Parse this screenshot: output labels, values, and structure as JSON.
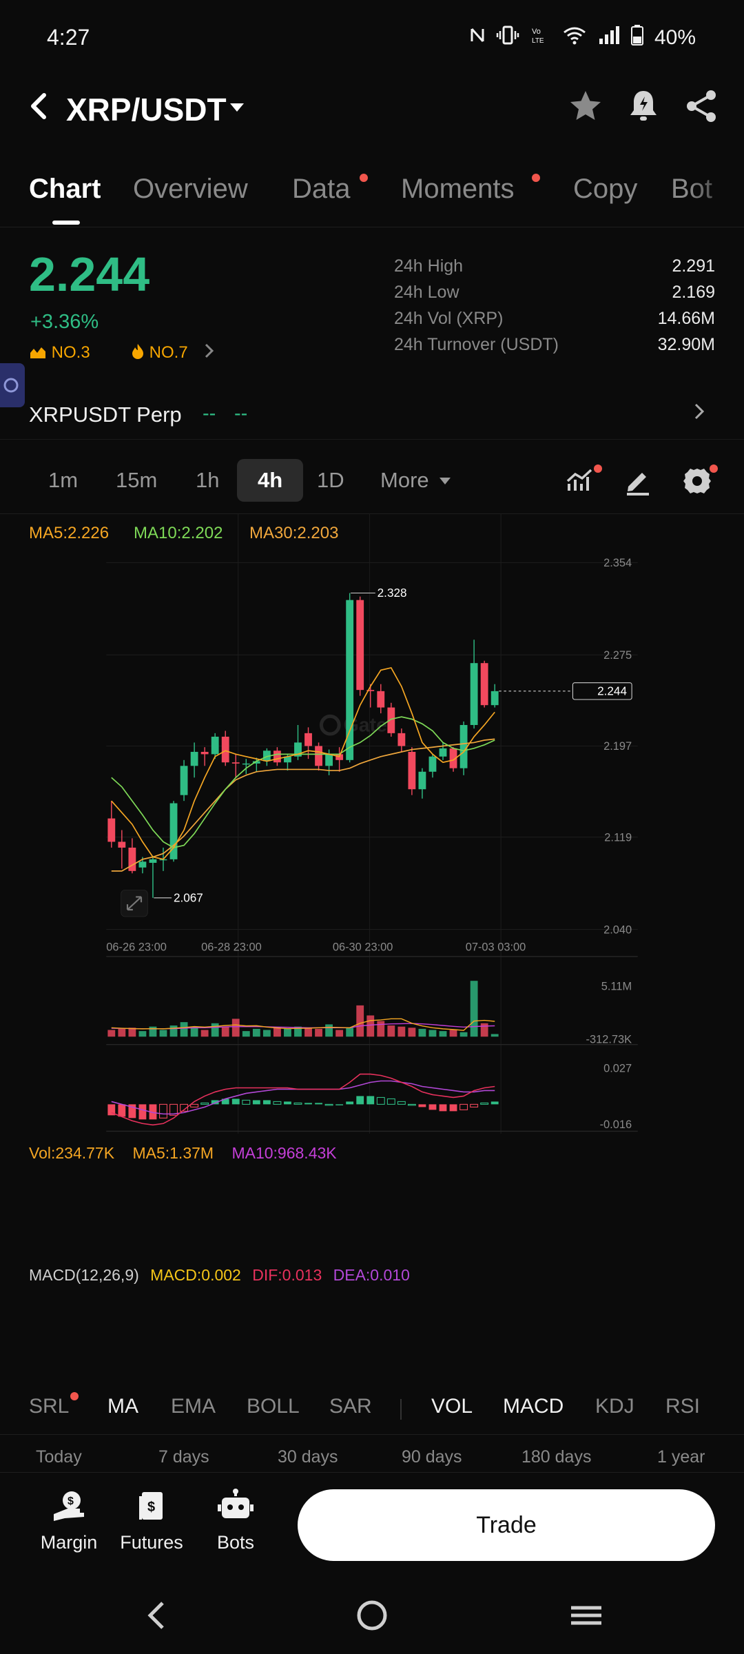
{
  "status_bar": {
    "time": "4:27",
    "battery": "40%",
    "icons": [
      "nfc-icon",
      "vibrate-icon",
      "volte-icon",
      "wifi-icon",
      "signal-icon",
      "battery-icon"
    ]
  },
  "header": {
    "pair": "XRP/USDT",
    "icons": [
      "back-arrow-icon",
      "caret-down-icon",
      "star-icon",
      "price-alert-bell-icon",
      "share-icon"
    ]
  },
  "tabs": [
    {
      "label": "Chart",
      "active": true,
      "dot": false
    },
    {
      "label": "Overview",
      "active": false,
      "dot": false
    },
    {
      "label": "Data",
      "active": false,
      "dot": true
    },
    {
      "label": "Moments",
      "active": false,
      "dot": true
    },
    {
      "label": "Copy",
      "active": false,
      "dot": false
    },
    {
      "label": "Bot",
      "active": false,
      "dot": false
    }
  ],
  "ticker": {
    "last_price": "2.244",
    "change": "+3.36%",
    "rank_hot": "NO.3",
    "rank_trend": "NO.7",
    "stats": [
      {
        "label": "24h High",
        "value": "2.291"
      },
      {
        "label": "24h Low",
        "value": "2.169"
      },
      {
        "label": "24h Vol (XRP)",
        "value": "14.66M"
      },
      {
        "label": "24h Turnover (USDT)",
        "value": "32.90M"
      }
    ]
  },
  "perp": {
    "name": "XRPUSDT Perp",
    "price": "--",
    "change": "--"
  },
  "intervals": [
    {
      "label": "1m",
      "active": false
    },
    {
      "label": "15m",
      "active": false
    },
    {
      "label": "1h",
      "active": false
    },
    {
      "label": "4h",
      "active": true
    },
    {
      "label": "1D",
      "active": false
    },
    {
      "label": "More",
      "active": false
    }
  ],
  "ma_legend": {
    "ma5": "MA5:2.226",
    "ma10": "MA10:2.202",
    "ma30": "MA30:2.203"
  },
  "colors": {
    "up": "#2fbd85",
    "down": "#f2495e",
    "ma5": "#f5a623",
    "ma10": "#7ed957",
    "ma30": "#f0a73c",
    "dif": "#e8315d",
    "dea": "#b348d8"
  },
  "chart_data": [
    {
      "type": "candlestick",
      "title": "",
      "ylim": [
        2.04,
        2.354
      ],
      "y_ticks": [
        "2.354",
        "2.275",
        "2.197",
        "2.119",
        "2.040"
      ],
      "x_ticks": [
        "06-26 23:00",
        "06-28 23:00",
        "06-30 23:00",
        "07-03 03:00"
      ],
      "last_price_label": "2.244",
      "high_marker": "2.328",
      "low_marker": "2.067",
      "candles": [
        {
          "o": 2.135,
          "h": 2.15,
          "l": 2.11,
          "c": 2.115
        },
        {
          "o": 2.115,
          "h": 2.125,
          "l": 2.092,
          "c": 2.11
        },
        {
          "o": 2.11,
          "h": 2.118,
          "l": 2.088,
          "c": 2.09
        },
        {
          "o": 2.093,
          "h": 2.102,
          "l": 2.088,
          "c": 2.098
        },
        {
          "o": 2.097,
          "h": 2.103,
          "l": 2.067,
          "c": 2.1
        },
        {
          "o": 2.1,
          "h": 2.11,
          "l": 2.09,
          "c": 2.1
        },
        {
          "o": 2.1,
          "h": 2.15,
          "l": 2.098,
          "c": 2.148
        },
        {
          "o": 2.155,
          "h": 2.185,
          "l": 2.15,
          "c": 2.18
        },
        {
          "o": 2.18,
          "h": 2.2,
          "l": 2.17,
          "c": 2.192
        },
        {
          "o": 2.192,
          "h": 2.196,
          "l": 2.18,
          "c": 2.19
        },
        {
          "o": 2.19,
          "h": 2.208,
          "l": 2.186,
          "c": 2.205
        },
        {
          "o": 2.205,
          "h": 2.21,
          "l": 2.18,
          "c": 2.183
        },
        {
          "o": 2.183,
          "h": 2.19,
          "l": 2.17,
          "c": 2.182
        },
        {
          "o": 2.182,
          "h": 2.186,
          "l": 2.173,
          "c": 2.182
        },
        {
          "o": 2.182,
          "h": 2.187,
          "l": 2.175,
          "c": 2.184
        },
        {
          "o": 2.184,
          "h": 2.195,
          "l": 2.18,
          "c": 2.193
        },
        {
          "o": 2.193,
          "h": 2.196,
          "l": 2.18,
          "c": 2.183
        },
        {
          "o": 2.183,
          "h": 2.19,
          "l": 2.176,
          "c": 2.188
        },
        {
          "o": 2.188,
          "h": 2.215,
          "l": 2.185,
          "c": 2.2
        },
        {
          "o": 2.208,
          "h": 2.213,
          "l": 2.186,
          "c": 2.197
        },
        {
          "o": 2.197,
          "h": 2.2,
          "l": 2.176,
          "c": 2.18
        },
        {
          "o": 2.18,
          "h": 2.194,
          "l": 2.172,
          "c": 2.19
        },
        {
          "o": 2.19,
          "h": 2.196,
          "l": 2.175,
          "c": 2.185
        },
        {
          "o": 2.185,
          "h": 2.328,
          "l": 2.183,
          "c": 2.322
        },
        {
          "o": 2.322,
          "h": 2.325,
          "l": 2.24,
          "c": 2.245
        },
        {
          "o": 2.245,
          "h": 2.25,
          "l": 2.23,
          "c": 2.244
        },
        {
          "o": 2.244,
          "h": 2.25,
          "l": 2.225,
          "c": 2.23
        },
        {
          "o": 2.23,
          "h": 2.234,
          "l": 2.205,
          "c": 2.208
        },
        {
          "o": 2.208,
          "h": 2.212,
          "l": 2.192,
          "c": 2.197
        },
        {
          "o": 2.192,
          "h": 2.196,
          "l": 2.155,
          "c": 2.16
        },
        {
          "o": 2.16,
          "h": 2.178,
          "l": 2.152,
          "c": 2.175
        },
        {
          "o": 2.175,
          "h": 2.19,
          "l": 2.17,
          "c": 2.188
        },
        {
          "o": 2.188,
          "h": 2.2,
          "l": 2.185,
          "c": 2.195
        },
        {
          "o": 2.195,
          "h": 2.196,
          "l": 2.175,
          "c": 2.178
        },
        {
          "o": 2.178,
          "h": 2.218,
          "l": 2.172,
          "c": 2.215
        },
        {
          "o": 2.215,
          "h": 2.288,
          "l": 2.212,
          "c": 2.268
        },
        {
          "o": 2.268,
          "h": 2.27,
          "l": 2.23,
          "c": 2.232
        },
        {
          "o": 2.232,
          "h": 2.25,
          "l": 2.23,
          "c": 2.244
        }
      ],
      "ma5": [
        2.15,
        2.14,
        2.13,
        2.115,
        2.102,
        2.1,
        2.11,
        2.125,
        2.15,
        2.17,
        2.188,
        2.193,
        2.19,
        2.188,
        2.186,
        2.184,
        2.186,
        2.188,
        2.19,
        2.193,
        2.192,
        2.19,
        2.188,
        2.21,
        2.232,
        2.248,
        2.262,
        2.264,
        2.248,
        2.225,
        2.2,
        2.19,
        2.183,
        2.185,
        2.192,
        2.205,
        2.215,
        2.226
      ],
      "ma10": [
        2.17,
        2.162,
        2.15,
        2.138,
        2.125,
        2.115,
        2.11,
        2.112,
        2.122,
        2.135,
        2.148,
        2.16,
        2.17,
        2.178,
        2.184,
        2.188,
        2.19,
        2.19,
        2.19,
        2.19,
        2.19,
        2.19,
        2.19,
        2.196,
        2.2,
        2.206,
        2.214,
        2.22,
        2.222,
        2.22,
        2.216,
        2.21,
        2.2,
        2.195,
        2.193,
        2.195,
        2.198,
        2.202
      ],
      "ma30": [
        2.09,
        2.09,
        2.095,
        2.1,
        2.102,
        2.105,
        2.112,
        2.12,
        2.13,
        2.14,
        2.15,
        2.16,
        2.168,
        2.172,
        2.175,
        2.176,
        2.177,
        2.177,
        2.177,
        2.177,
        2.177,
        2.176,
        2.176,
        2.178,
        2.182,
        2.185,
        2.188,
        2.19,
        2.192,
        2.194,
        2.195,
        2.196,
        2.197,
        2.198,
        2.199,
        2.2,
        2.202,
        2.203
      ]
    },
    {
      "type": "bar",
      "title": "Vol",
      "legend": {
        "vol": "Vol:234.77K",
        "ma5": "MA5:1.37M",
        "ma10": "MA10:968.43K"
      },
      "y_ticks": [
        "5.11M",
        "-312.73K"
      ],
      "ylim": [
        -0.31273,
        5.11
      ],
      "values": [
        0.6,
        0.7,
        0.8,
        0.5,
        0.9,
        0.6,
        1.0,
        1.3,
        0.9,
        0.6,
        1.2,
        0.9,
        1.6,
        0.5,
        0.7,
        0.6,
        0.8,
        0.7,
        0.9,
        0.8,
        0.7,
        1.1,
        0.6,
        0.8,
        2.8,
        1.9,
        1.4,
        1.0,
        0.9,
        0.8,
        0.7,
        0.6,
        0.5,
        0.6,
        0.4,
        5.0,
        1.2,
        0.23477
      ],
      "ma5": [
        0.8,
        0.75,
        0.72,
        0.7,
        0.72,
        0.7,
        0.76,
        0.82,
        0.9,
        0.86,
        0.92,
        1.0,
        1.05,
        0.96,
        0.98,
        0.86,
        0.78,
        0.72,
        0.74,
        0.76,
        0.8,
        0.84,
        0.82,
        0.8,
        1.2,
        1.44,
        1.5,
        1.6,
        1.6,
        1.2,
        0.96,
        0.8,
        0.7,
        0.64,
        0.56,
        1.4,
        1.46,
        1.37
      ],
      "ma10": [
        0.75,
        0.74,
        0.72,
        0.71,
        0.7,
        0.71,
        0.72,
        0.76,
        0.8,
        0.8,
        0.84,
        0.88,
        0.9,
        0.9,
        0.9,
        0.88,
        0.86,
        0.84,
        0.82,
        0.8,
        0.8,
        0.8,
        0.8,
        0.8,
        0.96,
        1.04,
        1.1,
        1.14,
        1.16,
        1.18,
        1.14,
        1.08,
        1.0,
        0.92,
        0.86,
        0.9,
        0.95,
        0.96843
      ]
    },
    {
      "type": "bar",
      "title": "MACD(12,26,9)",
      "legend": {
        "label": "MACD(12,26,9)",
        "macd": "MACD:0.002",
        "dif": "DIF:0.013",
        "dea": "DEA:0.010"
      },
      "y_ticks": [
        "0.027",
        "-0.016"
      ],
      "ylim": [
        -0.016,
        0.027
      ],
      "macd": [
        -0.008,
        -0.009,
        -0.01,
        -0.011,
        -0.011,
        -0.01,
        -0.008,
        -0.005,
        -0.002,
        0.001,
        0.003,
        0.004,
        0.004,
        0.003,
        0.003,
        0.003,
        0.002,
        0.002,
        0.001,
        0.001,
        0.001,
        0.0,
        0.0,
        0.002,
        0.006,
        0.006,
        0.005,
        0.004,
        0.002,
        0.0,
        -0.002,
        -0.004,
        -0.005,
        -0.005,
        -0.004,
        -0.002,
        0.001,
        0.002
      ],
      "dif": [
        -0.006,
        -0.009,
        -0.012,
        -0.014,
        -0.015,
        -0.014,
        -0.01,
        -0.004,
        0.002,
        0.006,
        0.009,
        0.011,
        0.012,
        0.012,
        0.012,
        0.012,
        0.012,
        0.012,
        0.011,
        0.011,
        0.011,
        0.011,
        0.011,
        0.016,
        0.022,
        0.022,
        0.021,
        0.019,
        0.016,
        0.013,
        0.009,
        0.007,
        0.006,
        0.005,
        0.006,
        0.01,
        0.012,
        0.013
      ],
      "dea": [
        0.002,
        0.0,
        -0.002,
        -0.004,
        -0.006,
        -0.007,
        -0.007,
        -0.006,
        -0.004,
        -0.002,
        0.001,
        0.004,
        0.006,
        0.008,
        0.009,
        0.01,
        0.011,
        0.011,
        0.011,
        0.011,
        0.011,
        0.011,
        0.011,
        0.012,
        0.014,
        0.016,
        0.017,
        0.017,
        0.016,
        0.015,
        0.013,
        0.012,
        0.011,
        0.01,
        0.009,
        0.009,
        0.01,
        0.01
      ]
    }
  ],
  "indicators": {
    "main": [
      "SRL",
      "MA",
      "EMA",
      "BOLL",
      "SAR"
    ],
    "sub": [
      "VOL",
      "MACD",
      "KDJ",
      "RSI"
    ]
  },
  "ranges": [
    "Today",
    "7 days",
    "30 days",
    "90 days",
    "180 days",
    "1 year"
  ],
  "bottom_nav": {
    "margin": "Margin",
    "futures": "Futures",
    "bots": "Bots",
    "trade": "Trade"
  }
}
